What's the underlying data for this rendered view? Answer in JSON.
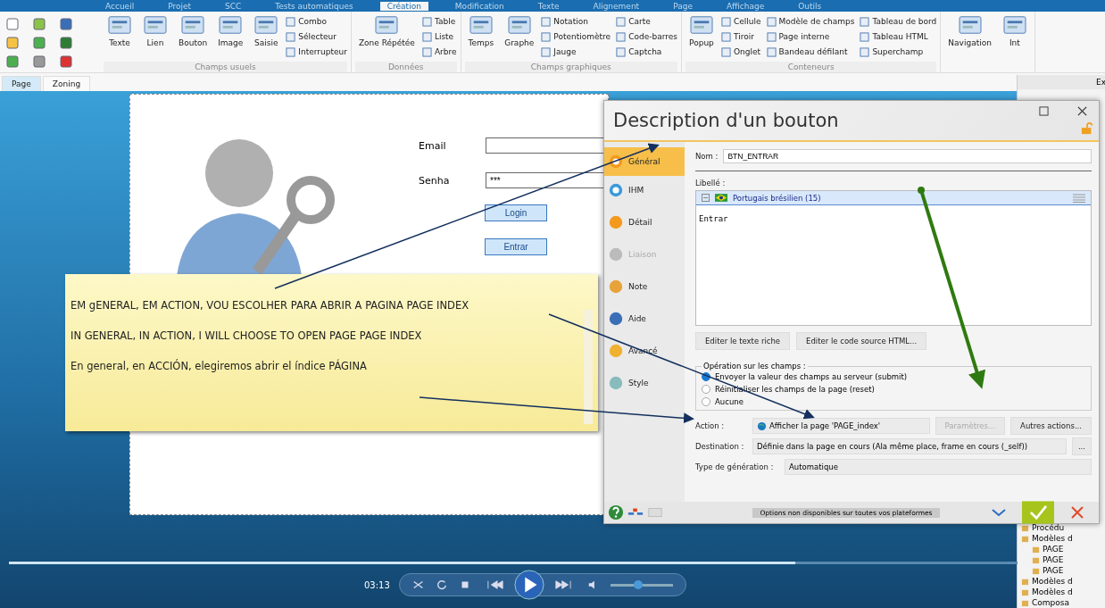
{
  "ribbon_tabs": [
    {
      "label": "Accueil",
      "selected": false
    },
    {
      "label": "Projet",
      "selected": false
    },
    {
      "label": "SCC",
      "selected": false
    },
    {
      "label": "Tests automatiques",
      "selected": false
    },
    {
      "label": "Création",
      "selected": true
    },
    {
      "label": "Modification",
      "selected": false
    },
    {
      "label": "Texte",
      "selected": false
    },
    {
      "label": "Alignement",
      "selected": false
    },
    {
      "label": "Page",
      "selected": false
    },
    {
      "label": "Affichage",
      "selected": false
    },
    {
      "label": "Outils",
      "selected": false
    }
  ],
  "ribbon_groups": [
    {
      "label": "Champs usuels",
      "large": [
        "Texte",
        "Lien",
        "Bouton",
        "Image",
        "Saisie"
      ],
      "small": [
        "Combo",
        "Sélecteur",
        "Interrupteur"
      ]
    },
    {
      "label": "Données",
      "large": [
        "Zone Répétée"
      ],
      "small": [
        "Table",
        "Liste",
        "Arbre"
      ]
    },
    {
      "label": "Champs graphiques",
      "large": [
        "Temps",
        "Graphe"
      ],
      "small": [
        "Notation",
        "Potentiomètre",
        "Jauge",
        "Carte",
        "Code-barres",
        "Captcha"
      ]
    },
    {
      "label": "Conteneurs",
      "large": [
        "Popup"
      ],
      "small": [
        "Cellule",
        "Tiroir",
        "Onglet",
        "Modèle de champs",
        "Page interne",
        "Bandeau défilant",
        "Tableau de bord",
        "Tableau HTML",
        "Superchamp"
      ]
    },
    {
      "large": [
        "Navigation",
        "Int"
      ]
    }
  ],
  "doc_tabs": [
    {
      "label": "Page",
      "selected": true
    },
    {
      "label": "Zoning",
      "selected": false
    }
  ],
  "canvas": {
    "fields": [
      {
        "label": "Email"
      },
      {
        "label": "Senha",
        "value": "***"
      }
    ],
    "buttons": [
      "Login",
      "Entrar"
    ]
  },
  "note": {
    "lines": [
      "EM gENERAL, EM ACTION, VOU ESCOLHER PARA ABRIR A PAGINA PAGE INDEX",
      "IN GENERAL, IN ACTION, I WILL CHOOSE TO OPEN PAGE PAGE INDEX",
      "En general, en ACCIÓN, elegiremos abrir el índice PÁGINA"
    ]
  },
  "dialog": {
    "title": "Description d'un bouton",
    "sections": [
      {
        "label": "Général",
        "kind": "general",
        "selected": true,
        "disabled": false
      },
      {
        "label": "IHM",
        "kind": "eye",
        "selected": false,
        "disabled": false
      },
      {
        "label": "Détail",
        "kind": "detail",
        "selected": false,
        "disabled": false
      },
      {
        "label": "Liaison",
        "kind": "link",
        "selected": false,
        "disabled": true
      },
      {
        "label": "Note",
        "kind": "pencil",
        "selected": false,
        "disabled": false
      },
      {
        "label": "Aide",
        "kind": "help",
        "selected": false,
        "disabled": false
      },
      {
        "label": "Avancé",
        "kind": "chevrons",
        "selected": false,
        "disabled": false
      },
      {
        "label": "Style",
        "kind": "palette",
        "selected": false,
        "disabled": false
      }
    ],
    "name_label": "Nom :",
    "name_value": "BTN_ENTRAR",
    "caption_label": "Libellé :",
    "language": "Portugais brésilien (15)",
    "caption_text": "Entrar",
    "edit_buttons": [
      "Editer le texte riche",
      "Editer le code source HTML..."
    ],
    "operation_title": "Opération sur les champs :",
    "options": [
      {
        "label": "Envoyer la valeur des champs au serveur (submit)",
        "selected": true
      },
      {
        "label": "Réinitialiser les champs de la page (reset)",
        "selected": false
      },
      {
        "label": "Aucune",
        "selected": false
      }
    ],
    "action_label": "Action :",
    "action_value": "Afficher la page 'PAGE_index'",
    "params_button": {
      "label": "Paramètres...",
      "disabled": true
    },
    "other_actions": "Autres actions...",
    "destination_label": "Destination :",
    "destination_value": "Définie dans la page en cours (Ala même place, frame en cours (_self))",
    "destination_more": "...",
    "generation_label": "Type de génération :",
    "generation_value": "Automatique",
    "footer_note": "Options non disponibles sur toutes vos plateformes"
  },
  "right_panel": {
    "header": "Ex",
    "tree": [
      {
        "label": "Procédu"
      },
      {
        "label": "Modèles d",
        "children": [
          {
            "label": "PAGE"
          },
          {
            "label": "PAGE"
          },
          {
            "label": "PAGE"
          }
        ]
      },
      {
        "label": "Modèles d"
      },
      {
        "label": "Modèles d"
      },
      {
        "label": "Composa"
      }
    ]
  },
  "player": {
    "time": "03:13",
    "progress": {
      "level": 0.78
    },
    "volume": {
      "level": 0.45
    }
  }
}
